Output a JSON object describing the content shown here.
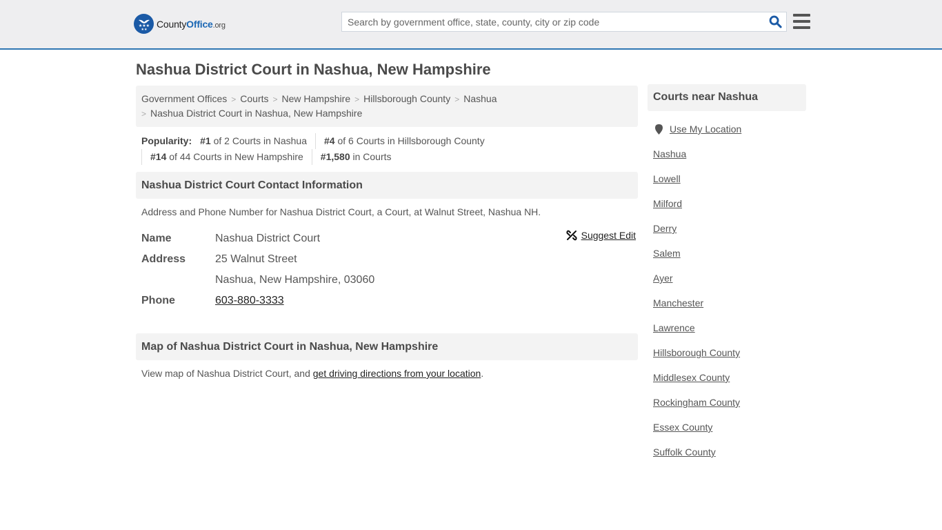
{
  "header": {
    "logo": {
      "county": "County",
      "office": "Office",
      "tld": ".org"
    },
    "search": {
      "placeholder": "Search by government office, state, county, city or zip code",
      "value": ""
    },
    "icons": {
      "search": "search-icon",
      "menu": "hamburger-menu-icon",
      "logo": "eagle-stars-logo-icon"
    }
  },
  "page": {
    "title": "Nashua District Court in Nashua, New Hampshire"
  },
  "breadcrumb": {
    "items": [
      "Government Offices",
      "Courts",
      "New Hampshire",
      "Hillsborough County",
      "Nashua"
    ],
    "current": "Nashua District Court in Nashua, New Hampshire",
    "separator": ">"
  },
  "popularity": {
    "label": "Popularity:",
    "items": [
      {
        "rank": "#1",
        "text": " of 2 Courts in Nashua"
      },
      {
        "rank": "#4",
        "text": " of 6 Courts in Hillsborough County"
      },
      {
        "rank": "#14",
        "text": " of 44 Courts in New Hampshire"
      },
      {
        "rank": "#1,580",
        "text": " in Courts"
      }
    ]
  },
  "contact": {
    "header": "Nashua District Court Contact Information",
    "description": "Address and Phone Number for Nashua District Court, a Court, at Walnut Street, Nashua NH.",
    "suggest_edit": "Suggest Edit",
    "fields": {
      "name_label": "Name",
      "name": "Nashua District Court",
      "address_label": "Address",
      "address_line1": "25 Walnut Street",
      "address_line2": "Nashua, New Hampshire, 03060",
      "phone_label": "Phone",
      "phone": "603-880-3333"
    }
  },
  "map": {
    "header": "Map of Nashua District Court in Nashua, New Hampshire",
    "text_before": "View map of Nashua District Court, and ",
    "link": "get driving directions from your location",
    "text_after": "."
  },
  "sidebar": {
    "header": "Courts near Nashua",
    "use_location": "Use My Location",
    "links": [
      "Nashua",
      "Lowell",
      "Milford",
      "Derry",
      "Salem",
      "Ayer",
      "Manchester",
      "Lawrence",
      "Hillsborough County",
      "Middlesex County",
      "Rockingham County",
      "Essex County",
      "Suffolk County"
    ]
  },
  "colors": {
    "accent": "#2e76b2",
    "brand": "#1b5aa6",
    "header_bg": "#eeeef0",
    "panel_bg": "#f3f3f3"
  }
}
